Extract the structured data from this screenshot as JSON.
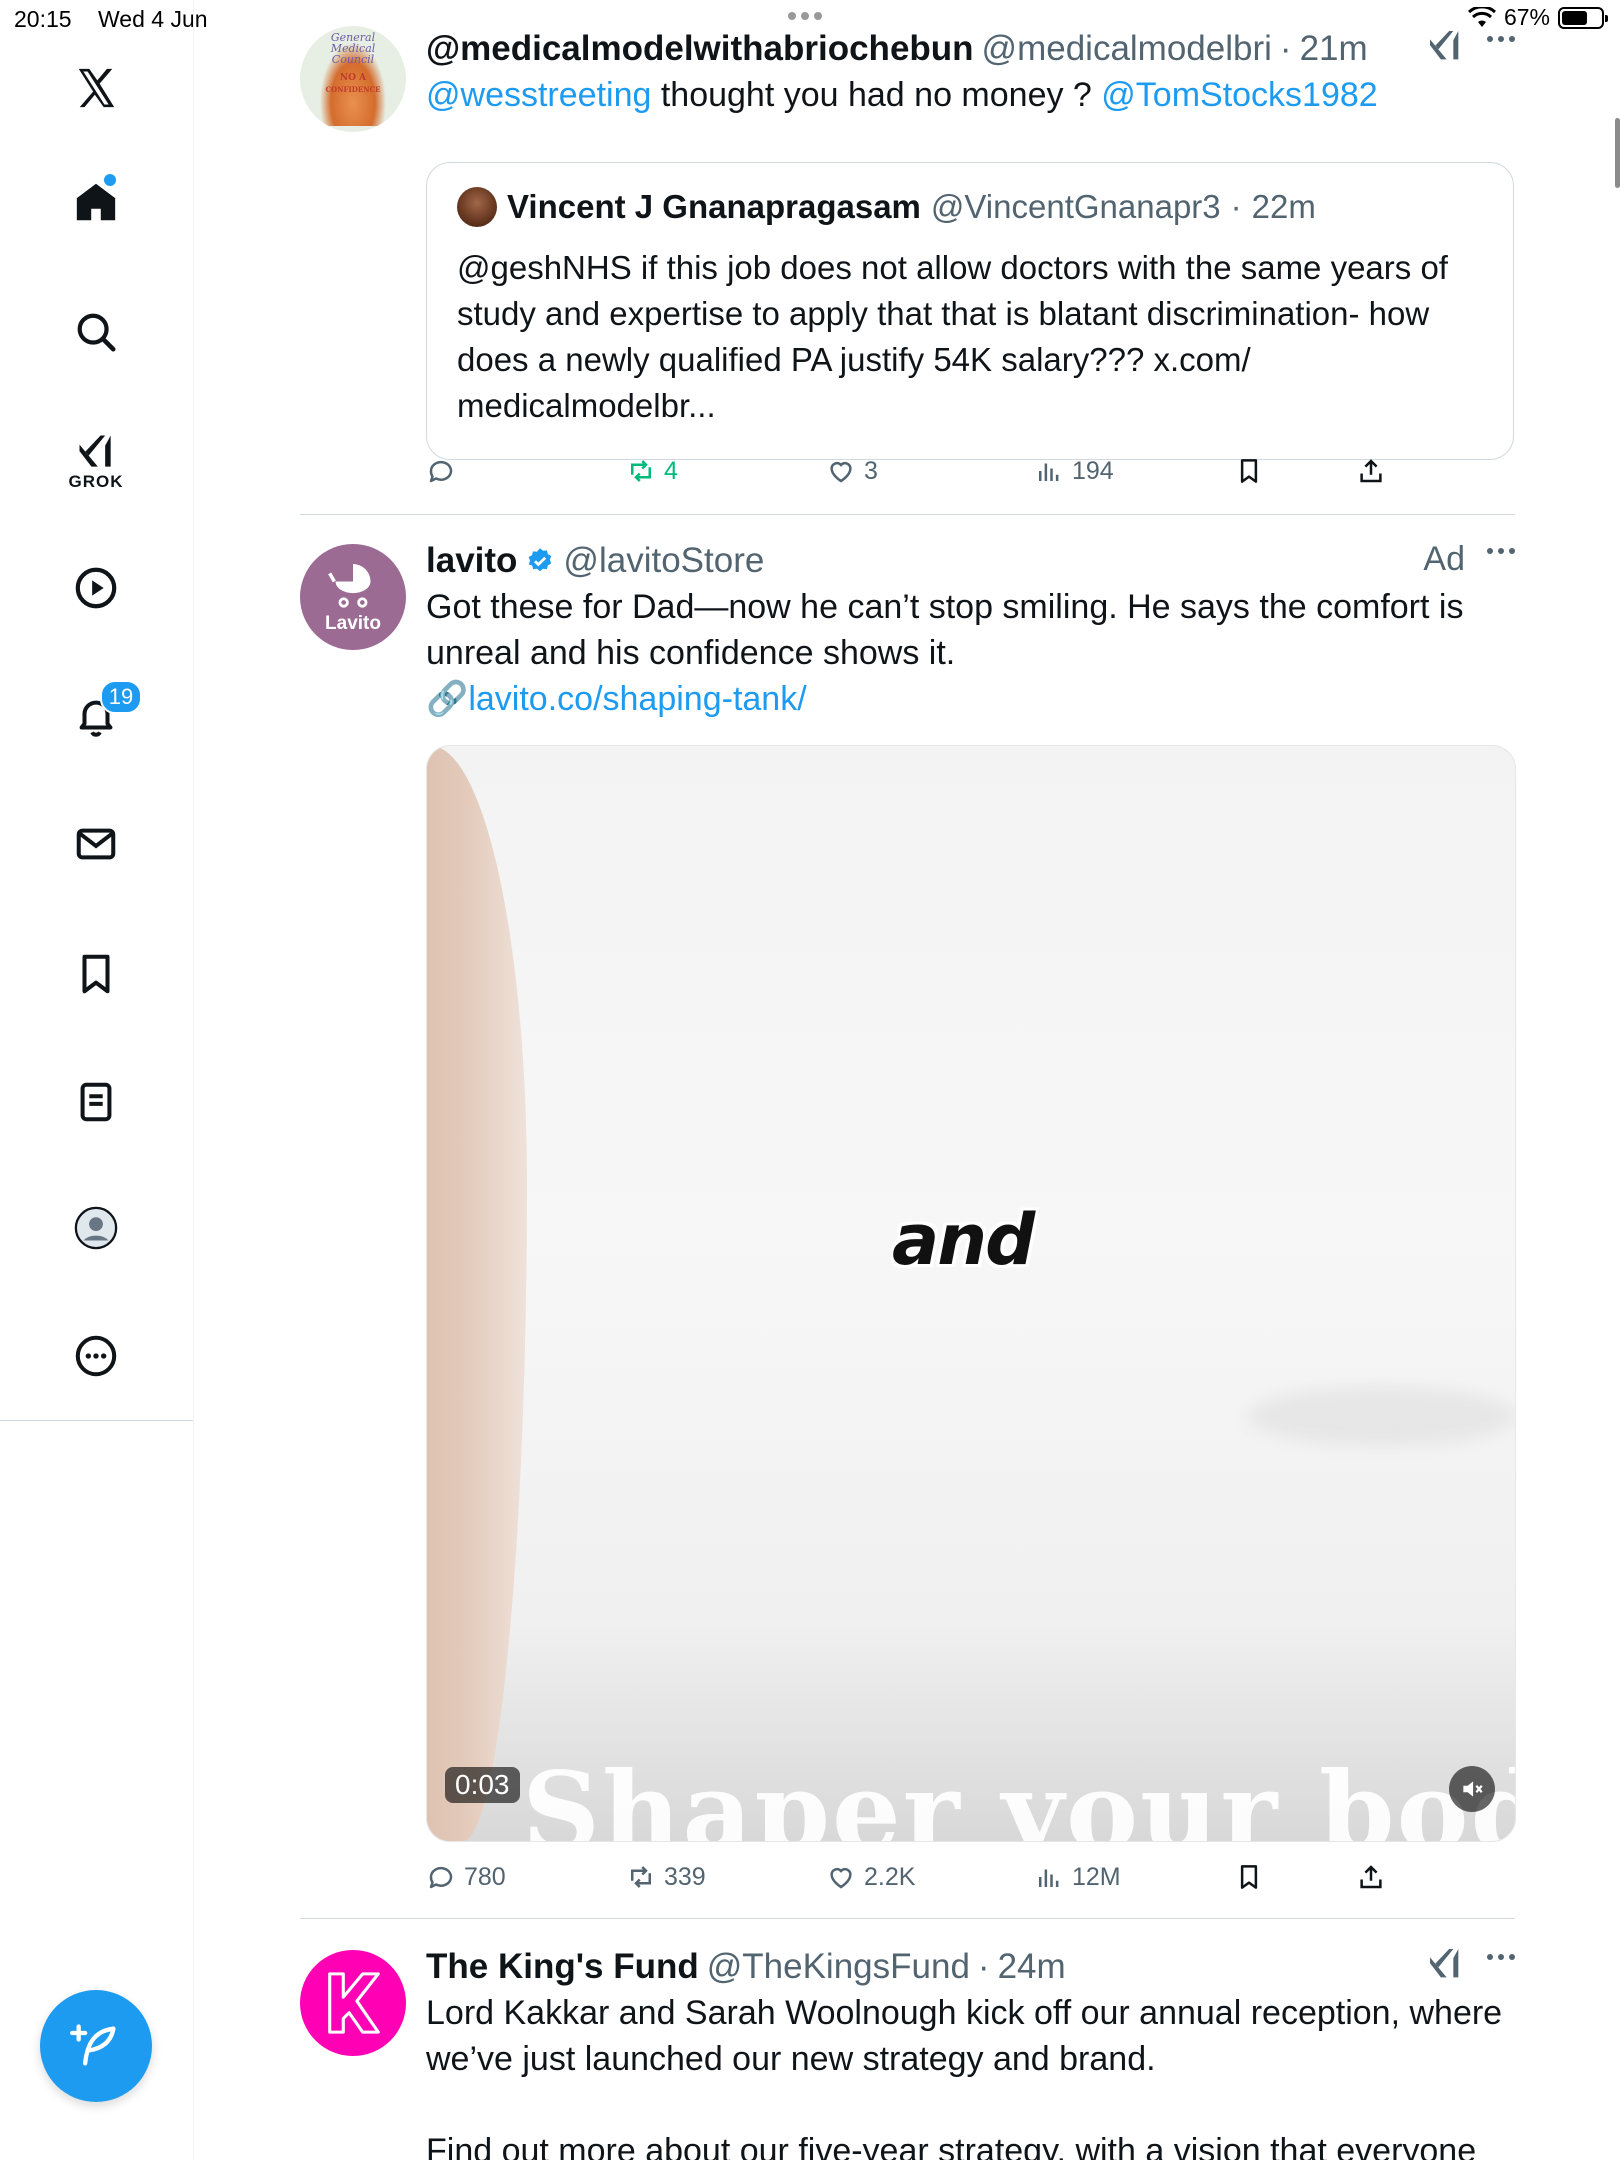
{
  "status": {
    "time": "20:15",
    "date": "Wed 4 Jun",
    "battery": "67%",
    "battery_level": 0.67
  },
  "sidebar": {
    "grok_label": "GROK",
    "notifications_badge": "19"
  },
  "posts": [
    {
      "name": "@medicalmodelwithabriochebun",
      "handle": "@medicalmodelbri",
      "time": "21m",
      "text_mention1": "@wesstreeting",
      "text_mid": " thought you had no money ? ",
      "text_mention2": "@TomStocks1982",
      "avatar_lines": [
        "General",
        "Medical",
        "Council",
        "NO A",
        "CONFIDENCE"
      ],
      "quote": {
        "name": "Vincent J Gnanapragasam",
        "handle": "@VincentGnanapr3",
        "time": "22m",
        "text": "@geshNHS if this job does not allow doctors with the same years of study and expertise to apply that that is blatant discrimination- how does a newly qualified PA justify 54K salary??? x.com/ medicalmodelbr..."
      },
      "actions": {
        "replies": "",
        "reposts": "4",
        "likes": "3",
        "views": "194"
      }
    },
    {
      "name": "lavito",
      "handle": "@lavitoStore",
      "ad_label": "Ad",
      "text": "Got these for Dad—now he can’t stop smiling. He says the comfort is unreal and his confidence shows it.",
      "link": "lavito.co/shaping-tank/",
      "avatar_label": "Lavito",
      "media": {
        "overlay_word": "and",
        "caption": "Shaper your body",
        "timer": "0:03"
      },
      "actions": {
        "replies": "780",
        "reposts": "339",
        "likes": "2.2K",
        "views": "12M"
      }
    },
    {
      "name": "The King's Fund",
      "handle": "@TheKingsFund",
      "time": "24m",
      "text": "Lord Kakkar and Sarah Woolnough kick off our annual reception, where we’ve just launched our new strategy and brand.",
      "text2": "Find out more about our five-year strategy, with a vision that everyone"
    }
  ],
  "colors": {
    "accent": "#1d9bf0",
    "repost_active": "#00ba7c",
    "secondary_text": "#536471",
    "king_fund_brand": "#ff00b4",
    "lavito_brand": "#9b6b93"
  }
}
